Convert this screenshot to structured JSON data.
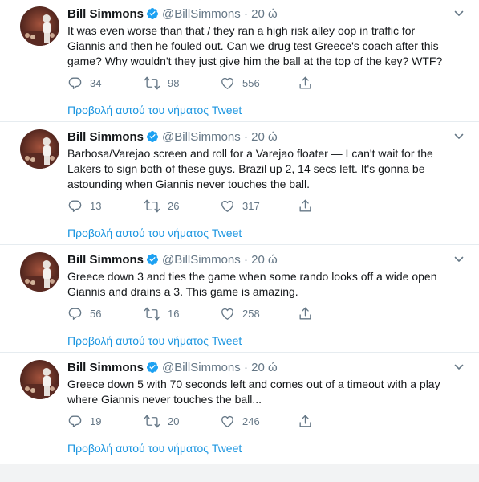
{
  "tweets": [
    {
      "name": "Bill Simmons",
      "handle": "@BillSimmons",
      "dot": "·",
      "time": "20 ώ",
      "text": "It was even worse than that / they ran a high risk alley oop in traffic for\nGiannis and then he fouled out. Can we drug test Greece's coach after this\ngame? Why wouldn't they just give him the ball at the top of the key? WTF?",
      "replies": "34",
      "retweets": "98",
      "likes": "556",
      "show_thread": "Προβολή αυτού του νήματος Tweet"
    },
    {
      "name": "Bill Simmons",
      "handle": "@BillSimmons",
      "dot": "·",
      "time": "20 ώ",
      "text": "Barbosa/Varejao screen and roll for a Varejao floater — I can't wait for the\nLakers to sign both of these guys. Brazil up 2, 14 secs left. It's gonna be\nastounding when Giannis never touches the ball.",
      "replies": "13",
      "retweets": "26",
      "likes": "317",
      "show_thread": "Προβολή αυτού του νήματος Tweet"
    },
    {
      "name": "Bill Simmons",
      "handle": "@BillSimmons",
      "dot": "·",
      "time": "20 ώ",
      "text": "Greece down 3 and ties the game when some rando looks off a wide open\nGiannis and drains a 3. This game is amazing.",
      "replies": "56",
      "retweets": "16",
      "likes": "258",
      "show_thread": "Προβολή αυτού του νήματος Tweet"
    },
    {
      "name": "Bill Simmons",
      "handle": "@BillSimmons",
      "dot": "·",
      "time": "20 ώ",
      "text": "Greece down 5 with 70 seconds left and comes out of a timeout with a play\nwhere Giannis never touches the ball...",
      "replies": "19",
      "retweets": "20",
      "likes": "246",
      "show_thread": "Προβολή αυτού του νήματος Tweet"
    }
  ],
  "colors": {
    "link": "#1b95e0",
    "verified": "#1da1f2",
    "muted": "#657786",
    "text": "#14171a"
  },
  "icons": [
    "verified-badge-icon",
    "chevron-down-icon",
    "reply-icon",
    "retweet-icon",
    "like-icon",
    "share-icon"
  ]
}
